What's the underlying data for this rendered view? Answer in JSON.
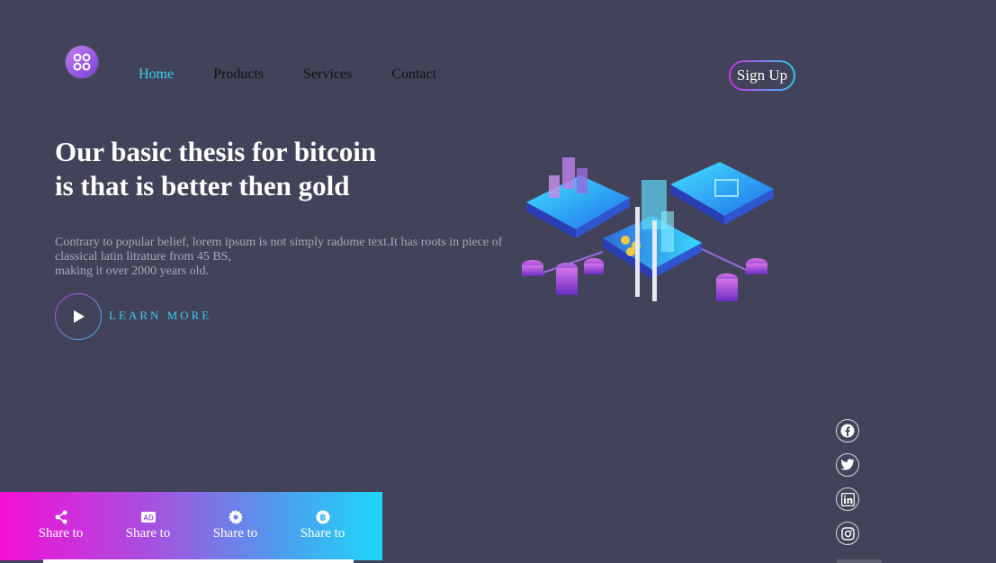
{
  "nav": {
    "items": [
      {
        "label": "Home",
        "active": true
      },
      {
        "label": "Products",
        "active": false
      },
      {
        "label": "Services",
        "active": false
      },
      {
        "label": "Contact",
        "active": false
      }
    ],
    "signup_label": "Sign Up"
  },
  "hero": {
    "headline_line1": "Our basic thesis for bitcoin",
    "headline_line2": "is that is better then gold",
    "description_line1": "Contrary to popular belief, lorem ipsum is not simply radome text.It has roots in piece of classical latin litrature from 45 BS,",
    "description_line2": "making it over 2000 years old.",
    "cta_label": "LEARN MORE"
  },
  "social": [
    "facebook-icon",
    "twitter-icon",
    "linkedin-icon",
    "instagram-icon"
  ],
  "share_bar": {
    "items": [
      {
        "icon": "share-icon",
        "label": "Share to"
      },
      {
        "icon": "ad-icon",
        "label": "Share to",
        "icon_text": "AD"
      },
      {
        "icon": "gear-icon",
        "label": "Share to"
      },
      {
        "icon": "bitcoin-icon",
        "label": "Share to"
      }
    ]
  },
  "colors": {
    "background": "#42435a",
    "accent_cyan": "#34d7ee",
    "accent_magenta": "#f30fd7"
  }
}
